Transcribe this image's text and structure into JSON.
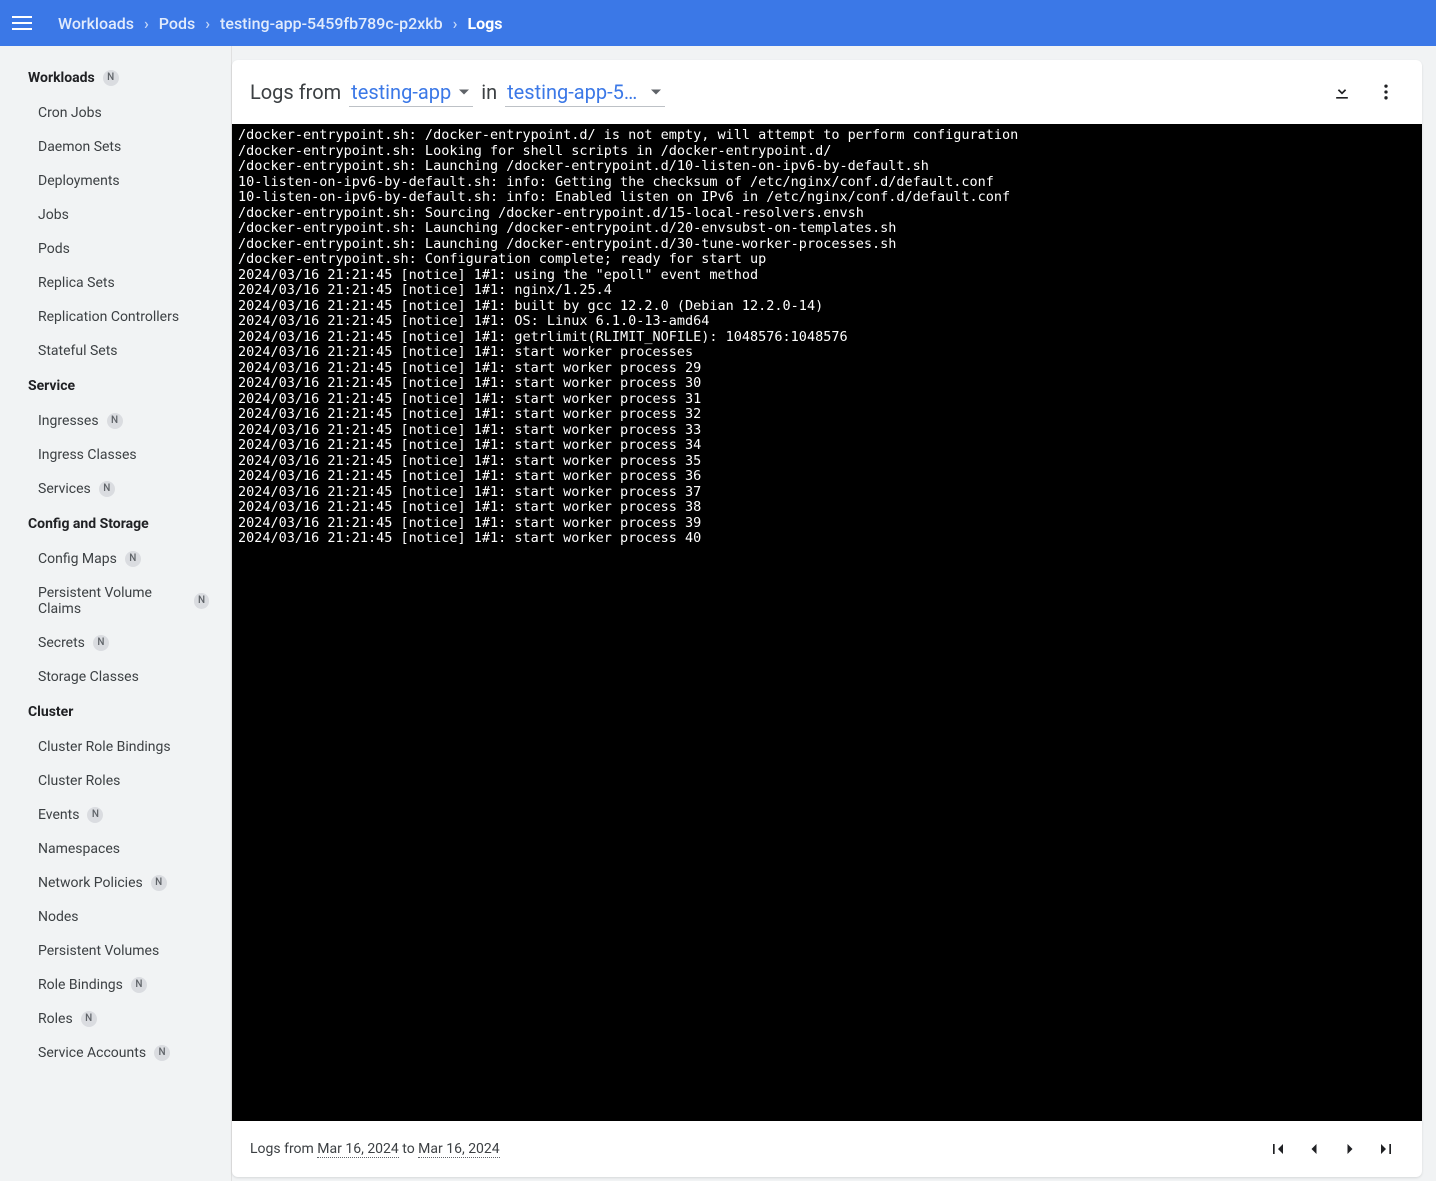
{
  "breadcrumb": [
    {
      "label": "Workloads"
    },
    {
      "label": "Pods"
    },
    {
      "label": "testing-app-5459fb789c-p2xkb"
    },
    {
      "label": "Logs"
    }
  ],
  "sidebar": {
    "sections": [
      {
        "title": "Workloads",
        "badge": "N",
        "items": [
          {
            "label": "Cron Jobs"
          },
          {
            "label": "Daemon Sets"
          },
          {
            "label": "Deployments"
          },
          {
            "label": "Jobs"
          },
          {
            "label": "Pods"
          },
          {
            "label": "Replica Sets"
          },
          {
            "label": "Replication Controllers"
          },
          {
            "label": "Stateful Sets"
          }
        ]
      },
      {
        "title": "Service",
        "items": [
          {
            "label": "Ingresses",
            "badge": "N"
          },
          {
            "label": "Ingress Classes"
          },
          {
            "label": "Services",
            "badge": "N"
          }
        ]
      },
      {
        "title": "Config and Storage",
        "items": [
          {
            "label": "Config Maps",
            "badge": "N"
          },
          {
            "label": "Persistent Volume Claims",
            "badge": "N"
          },
          {
            "label": "Secrets",
            "badge": "N"
          },
          {
            "label": "Storage Classes"
          }
        ]
      },
      {
        "title": "Cluster",
        "items": [
          {
            "label": "Cluster Role Bindings"
          },
          {
            "label": "Cluster Roles"
          },
          {
            "label": "Events",
            "badge": "N"
          },
          {
            "label": "Namespaces"
          },
          {
            "label": "Network Policies",
            "badge": "N"
          },
          {
            "label": "Nodes"
          },
          {
            "label": "Persistent Volumes"
          },
          {
            "label": "Role Bindings",
            "badge": "N"
          },
          {
            "label": "Roles",
            "badge": "N"
          },
          {
            "label": "Service Accounts",
            "badge": "N"
          }
        ]
      }
    ]
  },
  "logHeader": {
    "prefix": "Logs from",
    "container": "testing-app",
    "mid": "in",
    "pod": "testing-app-54…"
  },
  "logs": [
    "/docker-entrypoint.sh: /docker-entrypoint.d/ is not empty, will attempt to perform configuration",
    "/docker-entrypoint.sh: Looking for shell scripts in /docker-entrypoint.d/",
    "/docker-entrypoint.sh: Launching /docker-entrypoint.d/10-listen-on-ipv6-by-default.sh",
    "10-listen-on-ipv6-by-default.sh: info: Getting the checksum of /etc/nginx/conf.d/default.conf",
    "10-listen-on-ipv6-by-default.sh: info: Enabled listen on IPv6 in /etc/nginx/conf.d/default.conf",
    "/docker-entrypoint.sh: Sourcing /docker-entrypoint.d/15-local-resolvers.envsh",
    "/docker-entrypoint.sh: Launching /docker-entrypoint.d/20-envsubst-on-templates.sh",
    "/docker-entrypoint.sh: Launching /docker-entrypoint.d/30-tune-worker-processes.sh",
    "/docker-entrypoint.sh: Configuration complete; ready for start up",
    "2024/03/16 21:21:45 [notice] 1#1: using the \"epoll\" event method",
    "2024/03/16 21:21:45 [notice] 1#1: nginx/1.25.4",
    "2024/03/16 21:21:45 [notice] 1#1: built by gcc 12.2.0 (Debian 12.2.0-14)",
    "2024/03/16 21:21:45 [notice] 1#1: OS: Linux 6.1.0-13-amd64",
    "2024/03/16 21:21:45 [notice] 1#1: getrlimit(RLIMIT_NOFILE): 1048576:1048576",
    "2024/03/16 21:21:45 [notice] 1#1: start worker processes",
    "2024/03/16 21:21:45 [notice] 1#1: start worker process 29",
    "2024/03/16 21:21:45 [notice] 1#1: start worker process 30",
    "2024/03/16 21:21:45 [notice] 1#1: start worker process 31",
    "2024/03/16 21:21:45 [notice] 1#1: start worker process 32",
    "2024/03/16 21:21:45 [notice] 1#1: start worker process 33",
    "2024/03/16 21:21:45 [notice] 1#1: start worker process 34",
    "2024/03/16 21:21:45 [notice] 1#1: start worker process 35",
    "2024/03/16 21:21:45 [notice] 1#1: start worker process 36",
    "2024/03/16 21:21:45 [notice] 1#1: start worker process 37",
    "2024/03/16 21:21:45 [notice] 1#1: start worker process 38",
    "2024/03/16 21:21:45 [notice] 1#1: start worker process 39",
    "2024/03/16 21:21:45 [notice] 1#1: start worker process 40"
  ],
  "footer": {
    "prefix": "Logs from ",
    "from": "Mar 16, 2024",
    "mid": " to ",
    "to": "Mar 16, 2024"
  }
}
